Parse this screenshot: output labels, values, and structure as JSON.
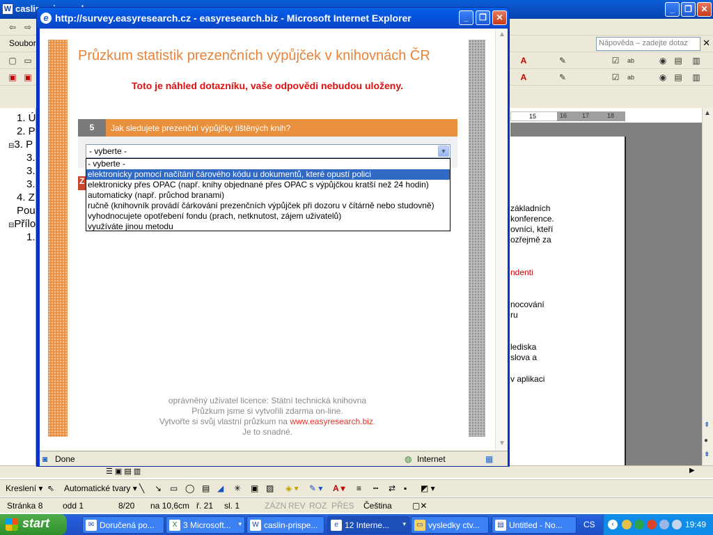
{
  "word": {
    "title": "caslin-prispevek",
    "menu_file": "Soubor",
    "help_placeholder": "Nápověda – zadejte dotaz",
    "ruler_15": "15",
    "ruler_16": "16",
    "ruler_17": "17",
    "ruler_18": "18",
    "outline": [
      "1. Ú",
      "2. P",
      "3. P",
      "3.",
      "3.",
      "3.",
      "4. Z",
      "Pou",
      "Přílo",
      "1."
    ],
    "doc_lines": [
      {
        "text": "  základních",
        "color": "#000"
      },
      {
        "text": "konference.",
        "color": "#000"
      },
      {
        "text": "ovníci,  kteří",
        "color": "#000"
      },
      {
        "text": "ozřejmě  za",
        "color": "#000"
      },
      {
        "text": "ndenti",
        "color": "#cc0000"
      },
      {
        "text": "nocování",
        "color": "#000"
      },
      {
        "text": "ru",
        "color": "#000"
      },
      {
        "text": "lediska",
        "color": "#000"
      },
      {
        "text": "slova a",
        "color": "#000"
      },
      {
        "text": "  v aplikaci",
        "color": "#000"
      }
    ],
    "draw_label": "Kreslení",
    "autoshapes_label": "Automatické tvary",
    "status": {
      "page": "Stránka  8",
      "section": "odd  1",
      "pages": "8/20",
      "at": "na  10,6cm",
      "line": "ř.  21",
      "col": "sl.  1",
      "rec": "ZÁZN",
      "trk": "REV",
      "ext": "ROZ",
      "ovr": "PŘES",
      "language": "Čeština"
    }
  },
  "ie": {
    "title": "http://survey.easyresearch.cz - easyresearch.biz - Microsoft Internet Explorer",
    "status_text": "Done",
    "zone_text": "Internet"
  },
  "survey": {
    "title": "Průzkum statistik prezenčních výpůjček v knihovnách ČR",
    "preview_note": "Toto je náhled dotazníku, vaše odpovědi nebudou uloženy.",
    "question_number": "5",
    "question_text": "Jak sledujete prezenční výpůjčky tištěných knih?",
    "select_value": "- vyberte -",
    "options": [
      "- vyberte -",
      "elektronicky pomocí načítání čárového kódu u dokumentů, které opustí polici",
      "elektronicky přes OPAC (např. knihy objednané přes OPAC s výpůjčkou kratší než 24 hodin)",
      "automaticky (např. průchod branami)",
      "ručně (knihovník provádí čárkování prezenčních výpůjček při dozoru v čítárně nebo studovně)",
      "vyhodnocujete opotřebení fondu (prach, netknutost, zájem uživatelů)",
      "využíváte jinou metodu"
    ],
    "selected_index": 1,
    "footer_license": "oprávněný uživatel licence: Státní technická knihovna",
    "footer_free": "Průzkum jsme si vytvořili zdarma on-line.",
    "footer_create_prefix": "Vytvořte si svůj vlastní průzkum na",
    "footer_link": "www.easyresearch.biz",
    "footer_link_suffix": ".",
    "footer_easy": "Je to snadné."
  },
  "taskbar": {
    "start": "start",
    "tasks": [
      {
        "label": "Doručená po...",
        "count": "",
        "icon": "outlook-icon",
        "active": false
      },
      {
        "label": "3 Microsoft...",
        "count": "▾",
        "icon": "excel-icon",
        "active": false
      },
      {
        "label": "caslin-prispe...",
        "count": "",
        "icon": "word-icon",
        "active": false
      },
      {
        "label": "12 Interne...",
        "count": "▾",
        "icon": "ie-icon",
        "active": true
      },
      {
        "label": "vysledky ctv...",
        "count": "",
        "icon": "folder-icon",
        "active": false
      },
      {
        "label": "Untitled - No...",
        "count": "",
        "icon": "notepad-icon",
        "active": false
      }
    ],
    "language": "CS",
    "clock": "19:49"
  }
}
